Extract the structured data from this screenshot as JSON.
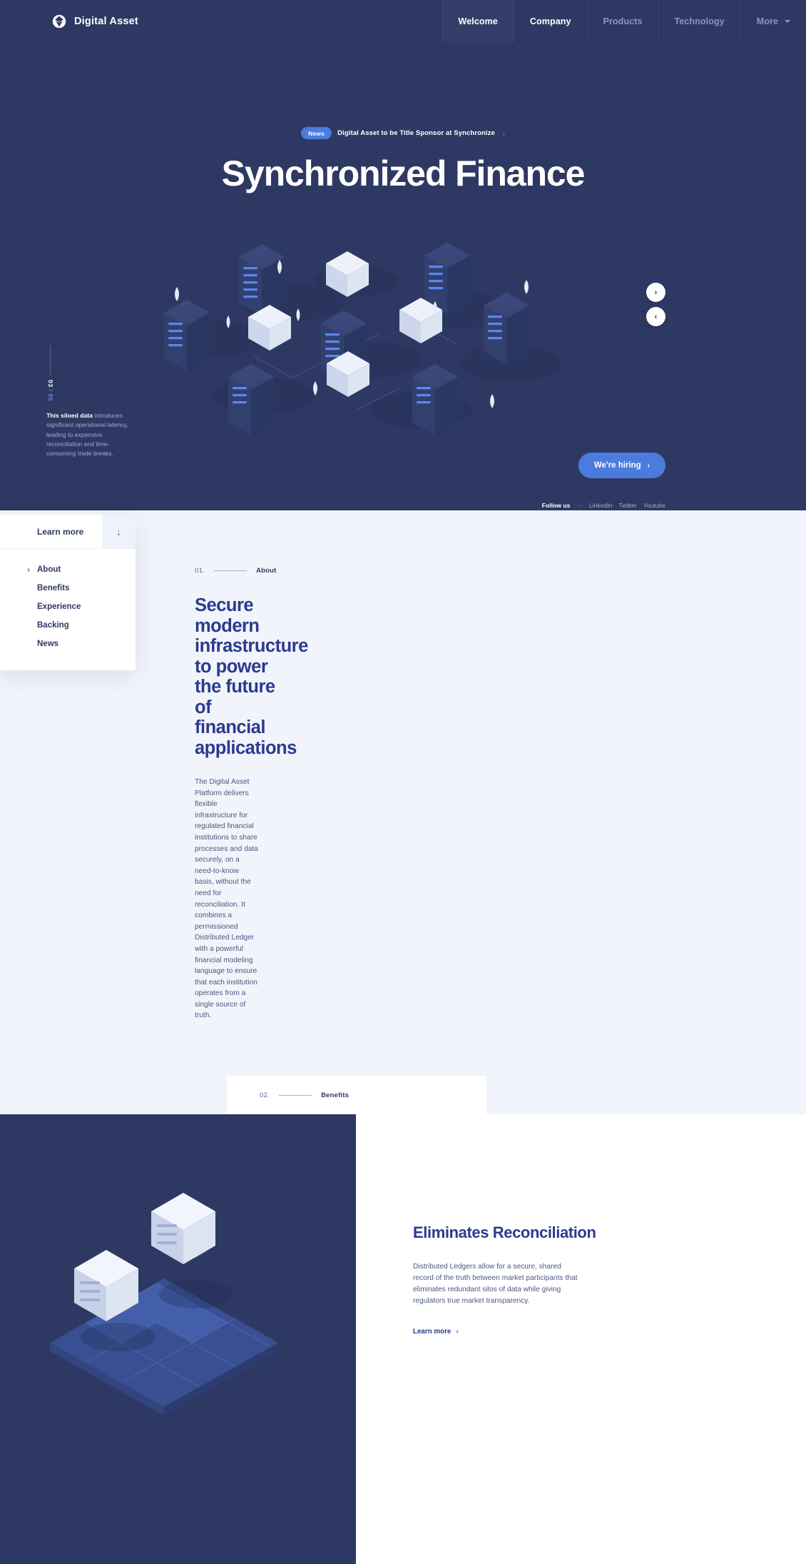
{
  "header": {
    "brand": "Digital Asset",
    "logo_icon": "digital-asset-logo-icon",
    "nav": [
      {
        "label": "Welcome",
        "state": "active"
      },
      {
        "label": "Company",
        "state": "bright"
      },
      {
        "label": "Products",
        "state": "dim"
      },
      {
        "label": "Technology",
        "state": "dim"
      },
      {
        "label": "More",
        "state": "dim",
        "caret": true
      }
    ]
  },
  "hero": {
    "news_badge": "News",
    "news_text": "Digital Asset to be Title Sponsor at Synchronize",
    "news_arrow": "›",
    "title": "Synchronized Finance",
    "slide_current": "03",
    "slide_sep": "/",
    "slide_total": "05",
    "caption_strong": "This siloed data",
    "caption_rest": " introduces significant operational latency, leading to expensive reconciliation and time-consuming trade breaks.",
    "next_icon": "›",
    "prev_icon": "‹",
    "hiring_label": "We're hiring",
    "hiring_chev": "›",
    "follow_label": "Follow us",
    "follow_dash": "—",
    "social": [
      "LinkedIn",
      "Twitter",
      "Youtube"
    ]
  },
  "menu_card": {
    "learn_more": "Learn more",
    "down_arrow": "↓",
    "items": [
      {
        "label": "About",
        "current": true
      },
      {
        "label": "Benefits",
        "current": false
      },
      {
        "label": "Experience",
        "current": false
      },
      {
        "label": "Backing",
        "current": false
      },
      {
        "label": "News",
        "current": false
      }
    ]
  },
  "about": {
    "eyebrow_num": "01.",
    "eyebrow_name": "About",
    "heading": "Secure modern infrastructure to power the future of financial applications",
    "body": "The Digital Asset Platform delivers flexible infrastructure for regulated financial institutions to share processes and data securely, on a need-to-know basis, without the need for reconciliation. It combines a permissioned Distributed Ledger with a powerful financial modeling language to ensure that each institution operates from a single source of truth."
  },
  "benefits": {
    "eyebrow_num": "02.",
    "eyebrow_name": "Benefits",
    "heading": "Eliminates Reconciliation",
    "body": "Distributed Ledgers allow for a secure, shared record of the truth between market participants that eliminates redundant silos of data while giving regulators true market transparency.",
    "link_label": "Learn more",
    "link_chev": "›"
  },
  "colors": {
    "navy": "#2e3963",
    "accent_blue": "#4b7bdd",
    "heading_blue": "#2b3a8f",
    "light_bg": "#f1f4fa"
  }
}
